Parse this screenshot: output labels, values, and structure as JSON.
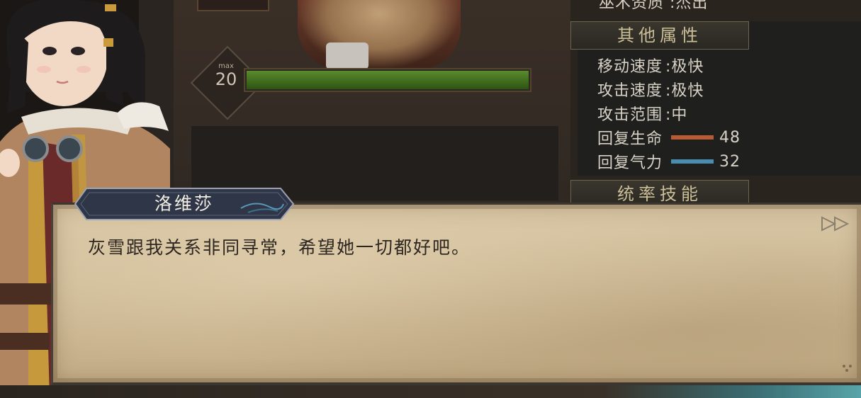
{
  "stats": {
    "top_line": "巫术资质 :杰出",
    "other_header": "其他属性",
    "rows": [
      {
        "label": "移动速度",
        "value": ":极快"
      },
      {
        "label": "攻击速度",
        "value": ":极快"
      },
      {
        "label": "攻击范围",
        "value": ":中"
      },
      {
        "label": "回复生命",
        "value": "48",
        "bar_color": "#b85a32"
      },
      {
        "label": "回复气力",
        "value": "32",
        "bar_color": "#4a8bb0"
      }
    ],
    "next_header": "统率技能"
  },
  "level": {
    "max_label": "max",
    "value": "20",
    "hp_fill_fraction": 1.0
  },
  "dialogue": {
    "speaker": "洛维莎",
    "text": "灰雪跟我关系非同寻常，希望她一切都好吧。"
  },
  "colors": {
    "hp_bar": "#4d7f26",
    "dialogue_bg": "#cdb995"
  },
  "icons": {
    "skip": "fast-forward-icon",
    "corner": "dots-icon"
  }
}
